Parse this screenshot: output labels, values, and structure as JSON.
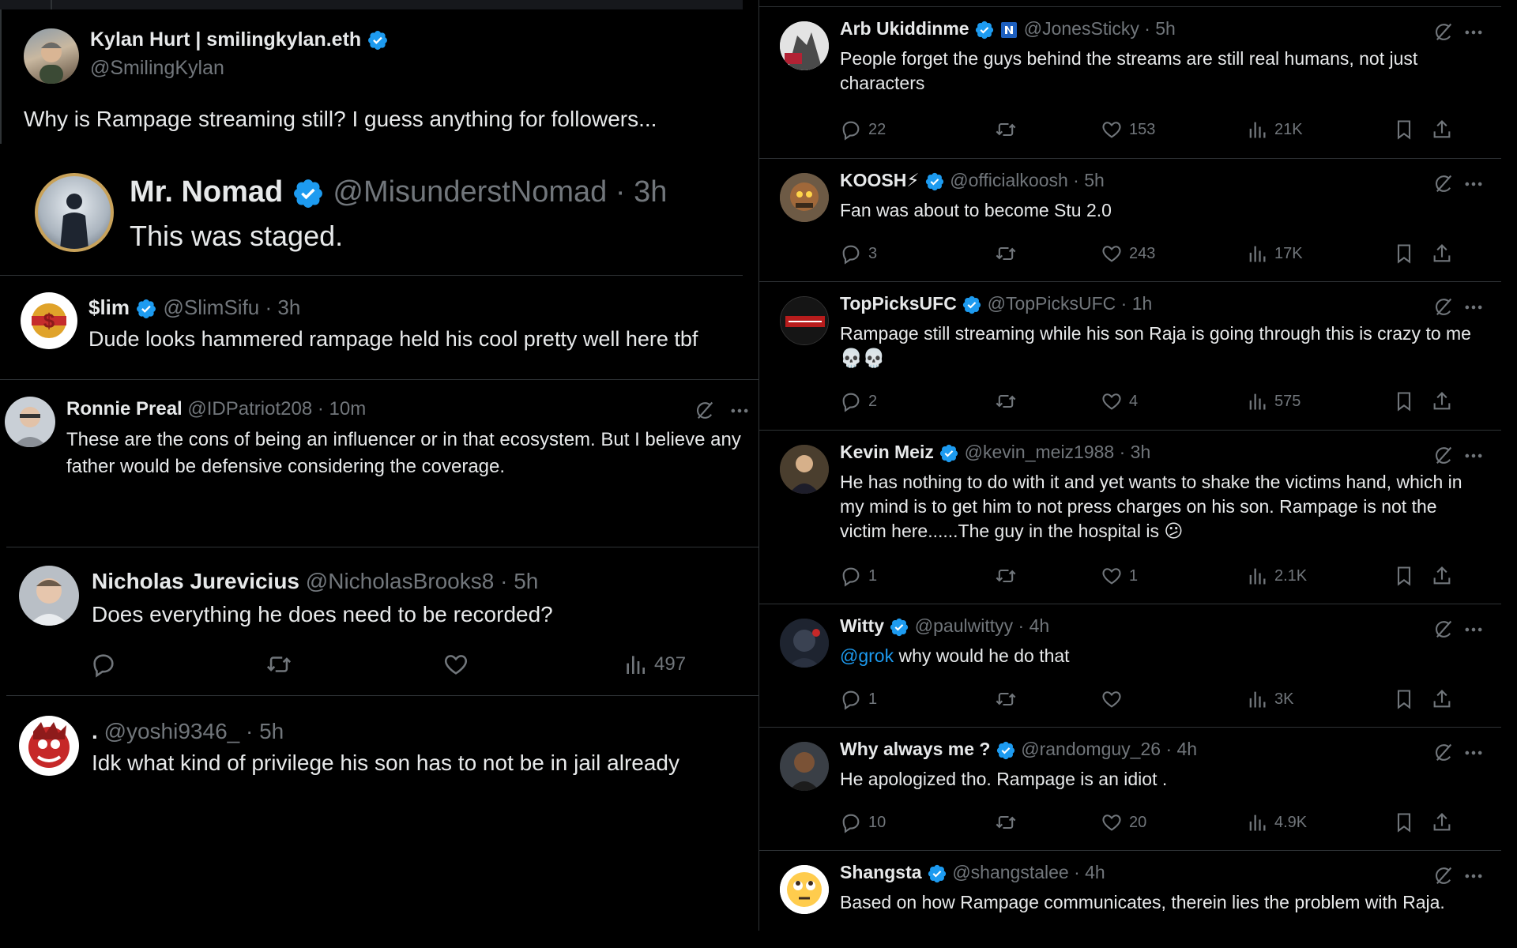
{
  "left": {
    "quoted_post": {
      "name": "Kylan Hurt | smilingkylan.eth",
      "handle": "@SmilingKylan",
      "text": "Why is Rampage streaming still? I guess anything for followers..."
    },
    "nomad_post": {
      "name": "Mr. Nomad",
      "handle": "@MisunderstNomad",
      "time": "· 3h",
      "text": "This was staged."
    },
    "slim_post": {
      "name": "$lim",
      "handle": "@SlimSifu",
      "time": "· 3h",
      "text": "Dude looks hammered rampage held his cool pretty well here tbf"
    },
    "ronnie_post": {
      "name": "Ronnie Preal",
      "handle": "@IDPatriot208",
      "time": "· 10m",
      "text": "These are the cons of being an influencer or in that ecosystem. But I believe any father would be defensive considering the coverage."
    },
    "nicholas_post": {
      "name": "Nicholas Jurevicius",
      "handle": "@NicholasBrooks8",
      "time": "· 5h",
      "text": "Does everything he does need to be recorded?",
      "views": "497"
    },
    "yoshi_post": {
      "name": ".",
      "handle": "@yoshi9346_",
      "time": "· 5h",
      "text": "Idk what kind of privilege his son has to not be in jail already"
    }
  },
  "right": {
    "tweets": [
      {
        "name": "Arb Ukiddinme",
        "handle": "@JonesSticky",
        "time": "· 5h",
        "text": "People forget the guys behind the streams are still real humans, not just characters",
        "replies": "22",
        "likes": "153",
        "views": "21K"
      },
      {
        "name": "KOOSH⚡",
        "handle": "@officialkoosh",
        "time": "· 5h",
        "text": "Fan was about to become Stu 2.0",
        "replies": "3",
        "likes": "243",
        "views": "17K"
      },
      {
        "name": "TopPicksUFC",
        "handle": "@TopPicksUFC",
        "time": "· 1h",
        "text": "Rampage still streaming while his son Raja is going through this is crazy to me 💀💀",
        "replies": "2",
        "likes": "4",
        "views": "575"
      },
      {
        "name": "Kevin Meiz",
        "handle": "@kevin_meiz1988",
        "time": "· 3h",
        "text": "He has nothing to do with it and yet wants to shake the victims hand, which in my mind is to get him to not press charges on his son. Rampage is not the victim here......The guy in the hospital is 😕",
        "replies": "1",
        "likes": "1",
        "views": "2.1K"
      },
      {
        "name": "Witty",
        "handle": "@paulwittyy",
        "time": "· 4h",
        "mention": "@grok",
        "text": " why would he do that",
        "replies": "1",
        "likes": "",
        "views": "3K"
      },
      {
        "name": "Why always me ?",
        "handle": "@randomguy_26",
        "time": "· 4h",
        "text": "He apologized tho. Rampage is an idiot .",
        "replies": "10",
        "likes": "20",
        "views": "4.9K"
      },
      {
        "name": "Shangsta",
        "handle": "@shangstalee",
        "time": "· 4h",
        "text": "Based on how Rampage communicates, therein lies the problem with Raja."
      }
    ]
  },
  "colors": {
    "verified": "#1d9bf0",
    "muted": "#71767b",
    "text": "#e7e9ea",
    "border": "#2f3336",
    "link": "#1d9bf0"
  }
}
